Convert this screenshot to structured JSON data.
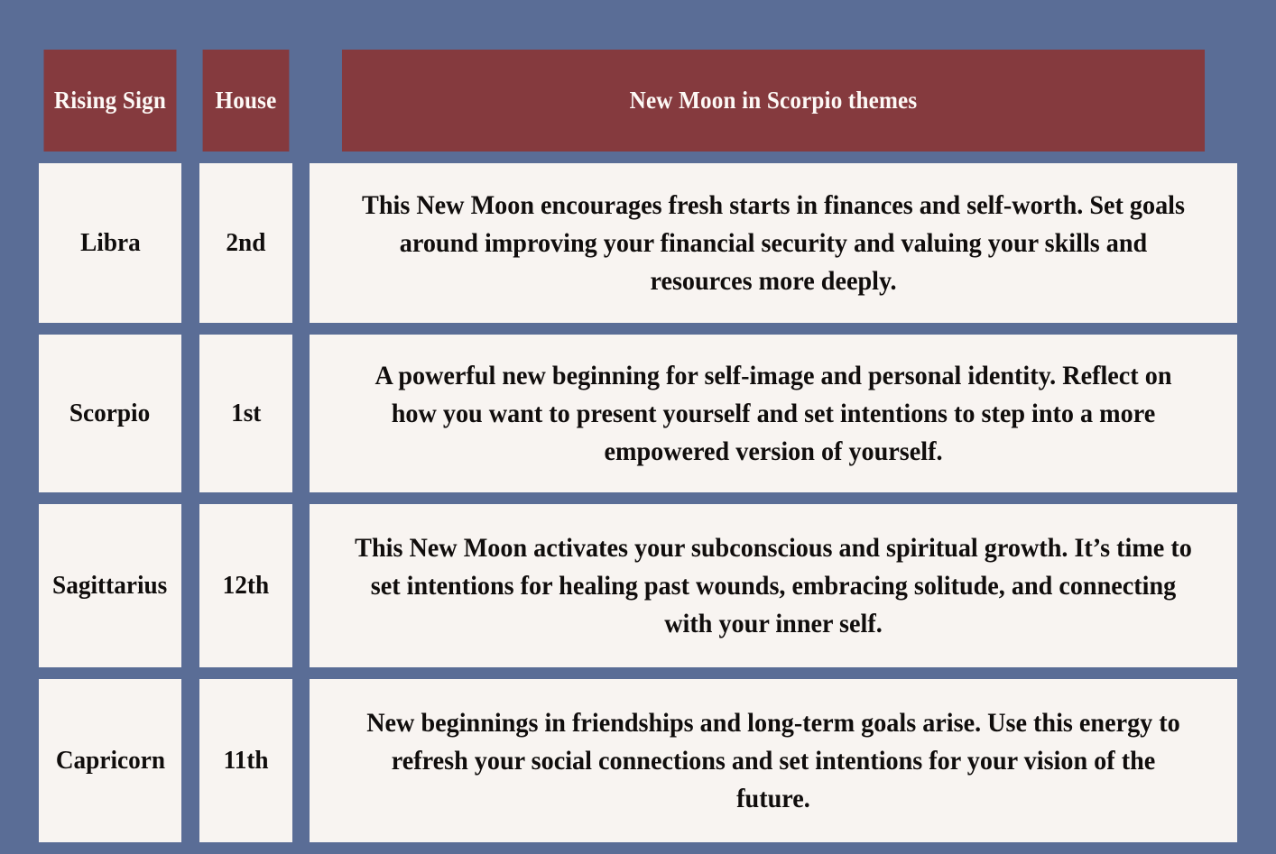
{
  "colors": {
    "page_background": "#5a6d96",
    "header_background": "#853a3e",
    "header_text": "#fdf9f6",
    "cell_background": "#f8f4f1",
    "cell_text": "#100d0c"
  },
  "table": {
    "columns": [
      {
        "key": "rising_sign",
        "label": "Rising Sign"
      },
      {
        "key": "house",
        "label": "House"
      },
      {
        "key": "themes",
        "label": "New Moon in Scorpio themes"
      }
    ],
    "rows": [
      {
        "rising_sign": "Libra",
        "house": "2nd",
        "themes": "This New Moon encourages fresh starts in finances and self-worth. Set goals around improving your financial security and valuing your skills and resources more deeply."
      },
      {
        "rising_sign": "Scorpio",
        "house": "1st",
        "themes": "A powerful new beginning for self-image and personal identity. Reflect on how you want to present yourself and set intentions to step into a more empowered version of yourself."
      },
      {
        "rising_sign": "Sagittarius",
        "house": "12th",
        "themes": "This New Moon activates your subconscious and spiritual growth. It’s time to set intentions for healing past wounds, embracing solitude, and connecting with your inner self."
      },
      {
        "rising_sign": "Capricorn",
        "house": "11th",
        "themes": "New beginnings in friendships and long-term goals arise. Use this energy to refresh your social connections and set intentions for your vision of the future."
      }
    ]
  }
}
